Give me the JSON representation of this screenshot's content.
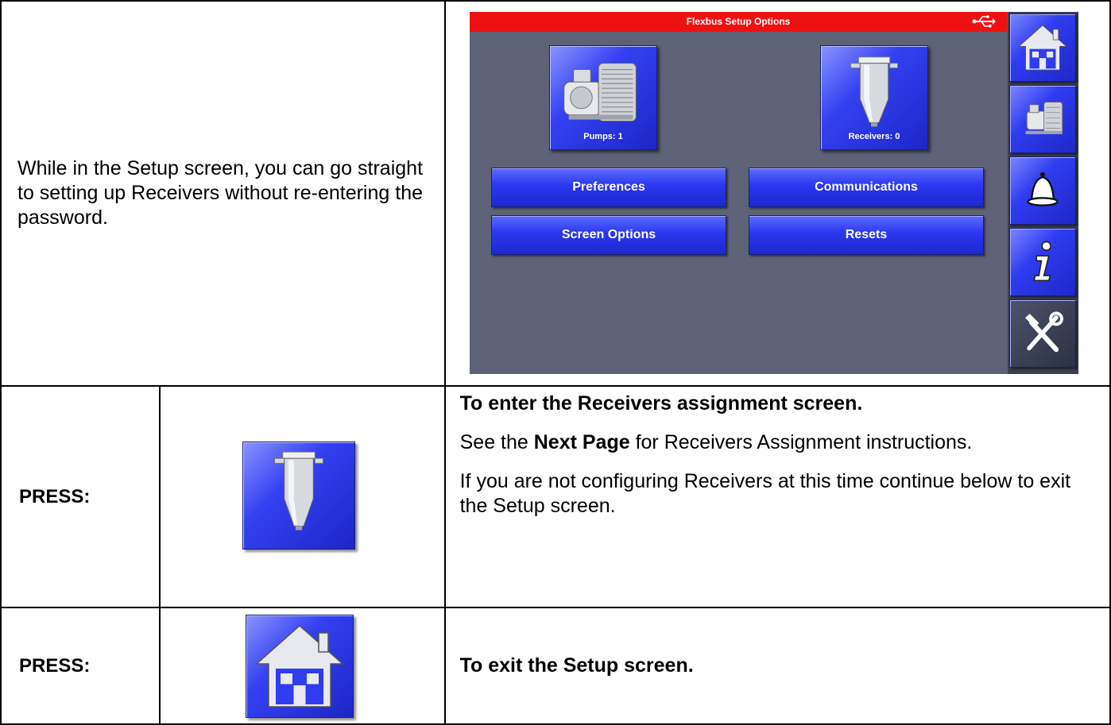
{
  "intro_text": "While in the Setup screen, you can go straight to setting up Receivers without re-entering the password.",
  "hmi": {
    "title": "Flexbus Setup Options",
    "tiles": [
      {
        "label": "Pumps: 1",
        "icon": "pump-icon"
      },
      {
        "label": "Receivers: 0",
        "icon": "receiver-icon"
      }
    ],
    "buttons": {
      "preferences": "Preferences",
      "communications": "Communications",
      "screen_options": "Screen Options",
      "resets": "Resets"
    },
    "sidebar": [
      "home-icon",
      "pump-icon",
      "bell-icon",
      "info-icon",
      "tools-icon"
    ]
  },
  "step1": {
    "press_label": "PRESS:",
    "heading": "To enter the Receivers assignment screen.",
    "see_prefix": "See the ",
    "see_bold": "Next Page",
    "see_suffix": " for Receivers Assignment instructions.",
    "note": "If you are not configuring Receivers at this time continue below to exit the Setup screen."
  },
  "step2": {
    "press_label": "PRESS:",
    "text": "To exit the Setup screen."
  },
  "colors": {
    "title_bar": "#ee1111",
    "screen_bg": "#5d6276",
    "button_blue": "#2a37ee"
  }
}
